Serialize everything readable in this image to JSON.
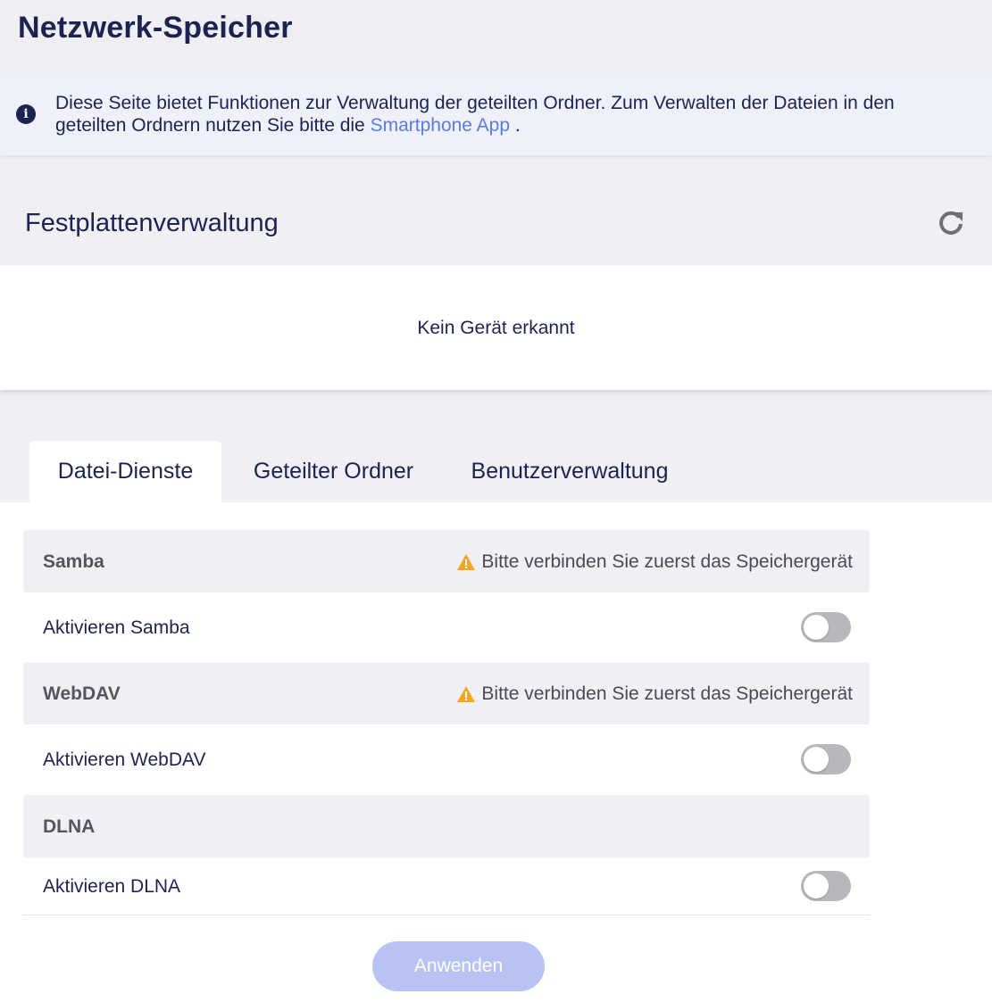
{
  "page": {
    "title": "Netzwerk-Speicher"
  },
  "info": {
    "text_before": "Diese Seite bietet Funktionen zur Verwaltung der geteilten Ordner. Zum Verwalten der Dateien in den geteilten Ordnern nutzen Sie bitte die",
    "link": "Smartphone App",
    "text_after": " ."
  },
  "disk": {
    "title": "Festplattenverwaltung",
    "empty": "Kein Gerät erkannt"
  },
  "tabs": [
    {
      "label": "Datei-Dienste",
      "active": true
    },
    {
      "label": "Geteilter Ordner",
      "active": false
    },
    {
      "label": "Benutzerverwaltung",
      "active": false
    }
  ],
  "services": [
    {
      "name": "Samba",
      "warning": "Bitte verbinden Sie zuerst das Speichergerät",
      "toggle_label": "Aktivieren Samba",
      "enabled": false
    },
    {
      "name": "WebDAV",
      "warning": "Bitte verbinden Sie zuerst das Speichergerät",
      "toggle_label": "Aktivieren WebDAV",
      "enabled": false
    },
    {
      "name": "DLNA",
      "warning": "",
      "toggle_label": "Aktivieren DLNA",
      "enabled": false
    }
  ],
  "apply_label": "Anwenden",
  "colors": {
    "primary_text": "#1d2350",
    "link": "#5b7be0",
    "warning": "#f5a623",
    "button_disabled": "#b9c3f3",
    "toggle_off": "#b8b8bc"
  }
}
